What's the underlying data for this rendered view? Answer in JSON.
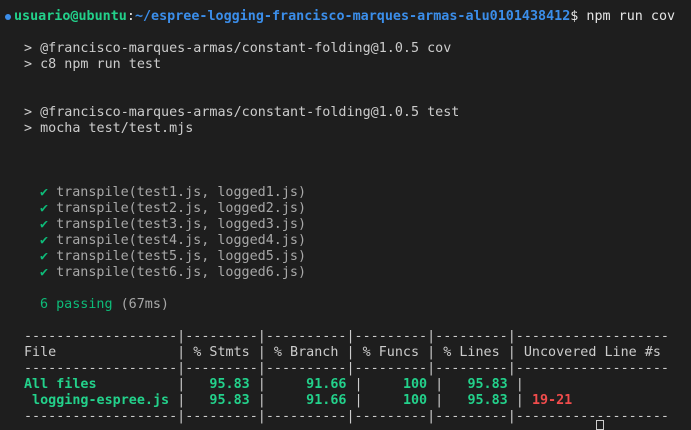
{
  "prompt": {
    "user_host": "usuario@ubuntu",
    "separator": ":",
    "path": "~/espree-logging-francisco-marques-armas-alu0101438412",
    "symbol": "$",
    "command": " npm run cov"
  },
  "script_cov": {
    "line1": "> @francisco-marques-armas/constant-folding@1.0.5 cov",
    "line2": "> c8 npm run test"
  },
  "script_test": {
    "line1": "> @francisco-marques-armas/constant-folding@1.0.5 test",
    "line2": "> mocha test/test.mjs"
  },
  "tests": {
    "check_glyph": "✔",
    "items": [
      "transpile(test1.js, logged1.js)",
      "transpile(test2.js, logged2.js)",
      "transpile(test3.js, logged3.js)",
      "transpile(test4.js, logged4.js)",
      "transpile(test5.js, logged5.js)",
      "transpile(test6.js, logged6.js)"
    ],
    "passing": "6 passing",
    "duration": "(67ms)"
  },
  "coverage": {
    "separator_line": "-------------------|---------|----------|---------|---------|-------------------",
    "header": "File               | % Stmts | % Branch | % Funcs | % Lines | Uncovered Line #s ",
    "all_files": {
      "name": "All files          ",
      "bar1": "| ",
      "stmts": "  95.83",
      "bar2": " |   ",
      "branch": "  91.66",
      "bar3": " |     ",
      "funcs": "100",
      "bar4": " |   ",
      "lines": "95.83",
      "bar5": " |"
    },
    "row": {
      "name": " logging-espree.js ",
      "bar1": "| ",
      "stmts": "  95.83",
      "bar2": " |   ",
      "branch": "  91.66",
      "bar3": " |     ",
      "funcs": "100",
      "bar4": " |   ",
      "lines": "95.83",
      "bar5": " | ",
      "uncovered": "19-21"
    }
  },
  "colors": {
    "background": "#1e1e1e",
    "user": "#23d18b",
    "path": "#3b8eea",
    "covered": "#23d18b",
    "uncovered": "#f14c4c"
  }
}
